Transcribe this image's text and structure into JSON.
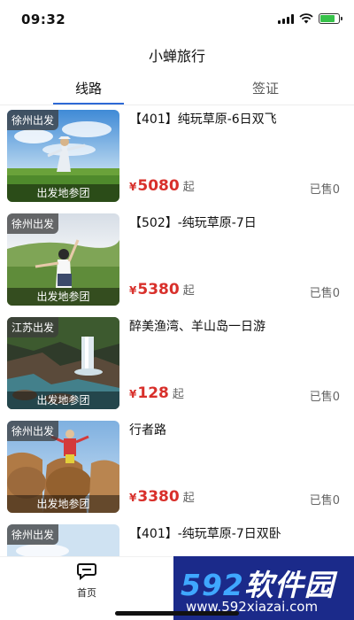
{
  "status": {
    "time": "09:32",
    "battery_level": 0.8
  },
  "app": {
    "title": "小蝉旅行"
  },
  "tabs": [
    {
      "label": "线路",
      "active": true
    },
    {
      "label": "签证",
      "active": false
    }
  ],
  "thumb_footer_label": "出发地参团",
  "currency_symbol": "¥",
  "price_suffix": "起",
  "cards": [
    {
      "badge": "徐州出发",
      "title": "【401】纯玩草原-6日双飞",
      "price": "5080",
      "sold": "已售0",
      "scene": "grassland-dancer"
    },
    {
      "badge": "徐州出发",
      "title": "【502】-纯玩草原-7日",
      "price": "5380",
      "sold": "已售0",
      "scene": "grassland-arms"
    },
    {
      "badge": "江苏出发",
      "title": "醉美渔湾、羊山岛一日游",
      "price": "128",
      "sold": "已售0",
      "scene": "waterfall"
    },
    {
      "badge": "徐州出发",
      "title": "行者路",
      "price": "3380",
      "sold": "已售0",
      "scene": "camels"
    },
    {
      "badge": "徐州出发",
      "title": "【401】-纯玩草原-7日双卧",
      "price": "",
      "sold": "",
      "scene": "sky"
    }
  ],
  "bottom_nav": {
    "home_label": "首页"
  },
  "watermark": {
    "line1_nums": "592",
    "line1_text": "软件园",
    "line2": "www.592xiazai.com"
  },
  "colors": {
    "accent": "#2d69d6",
    "price": "#d8302b",
    "watermark_bg": "#1b2a8a"
  }
}
